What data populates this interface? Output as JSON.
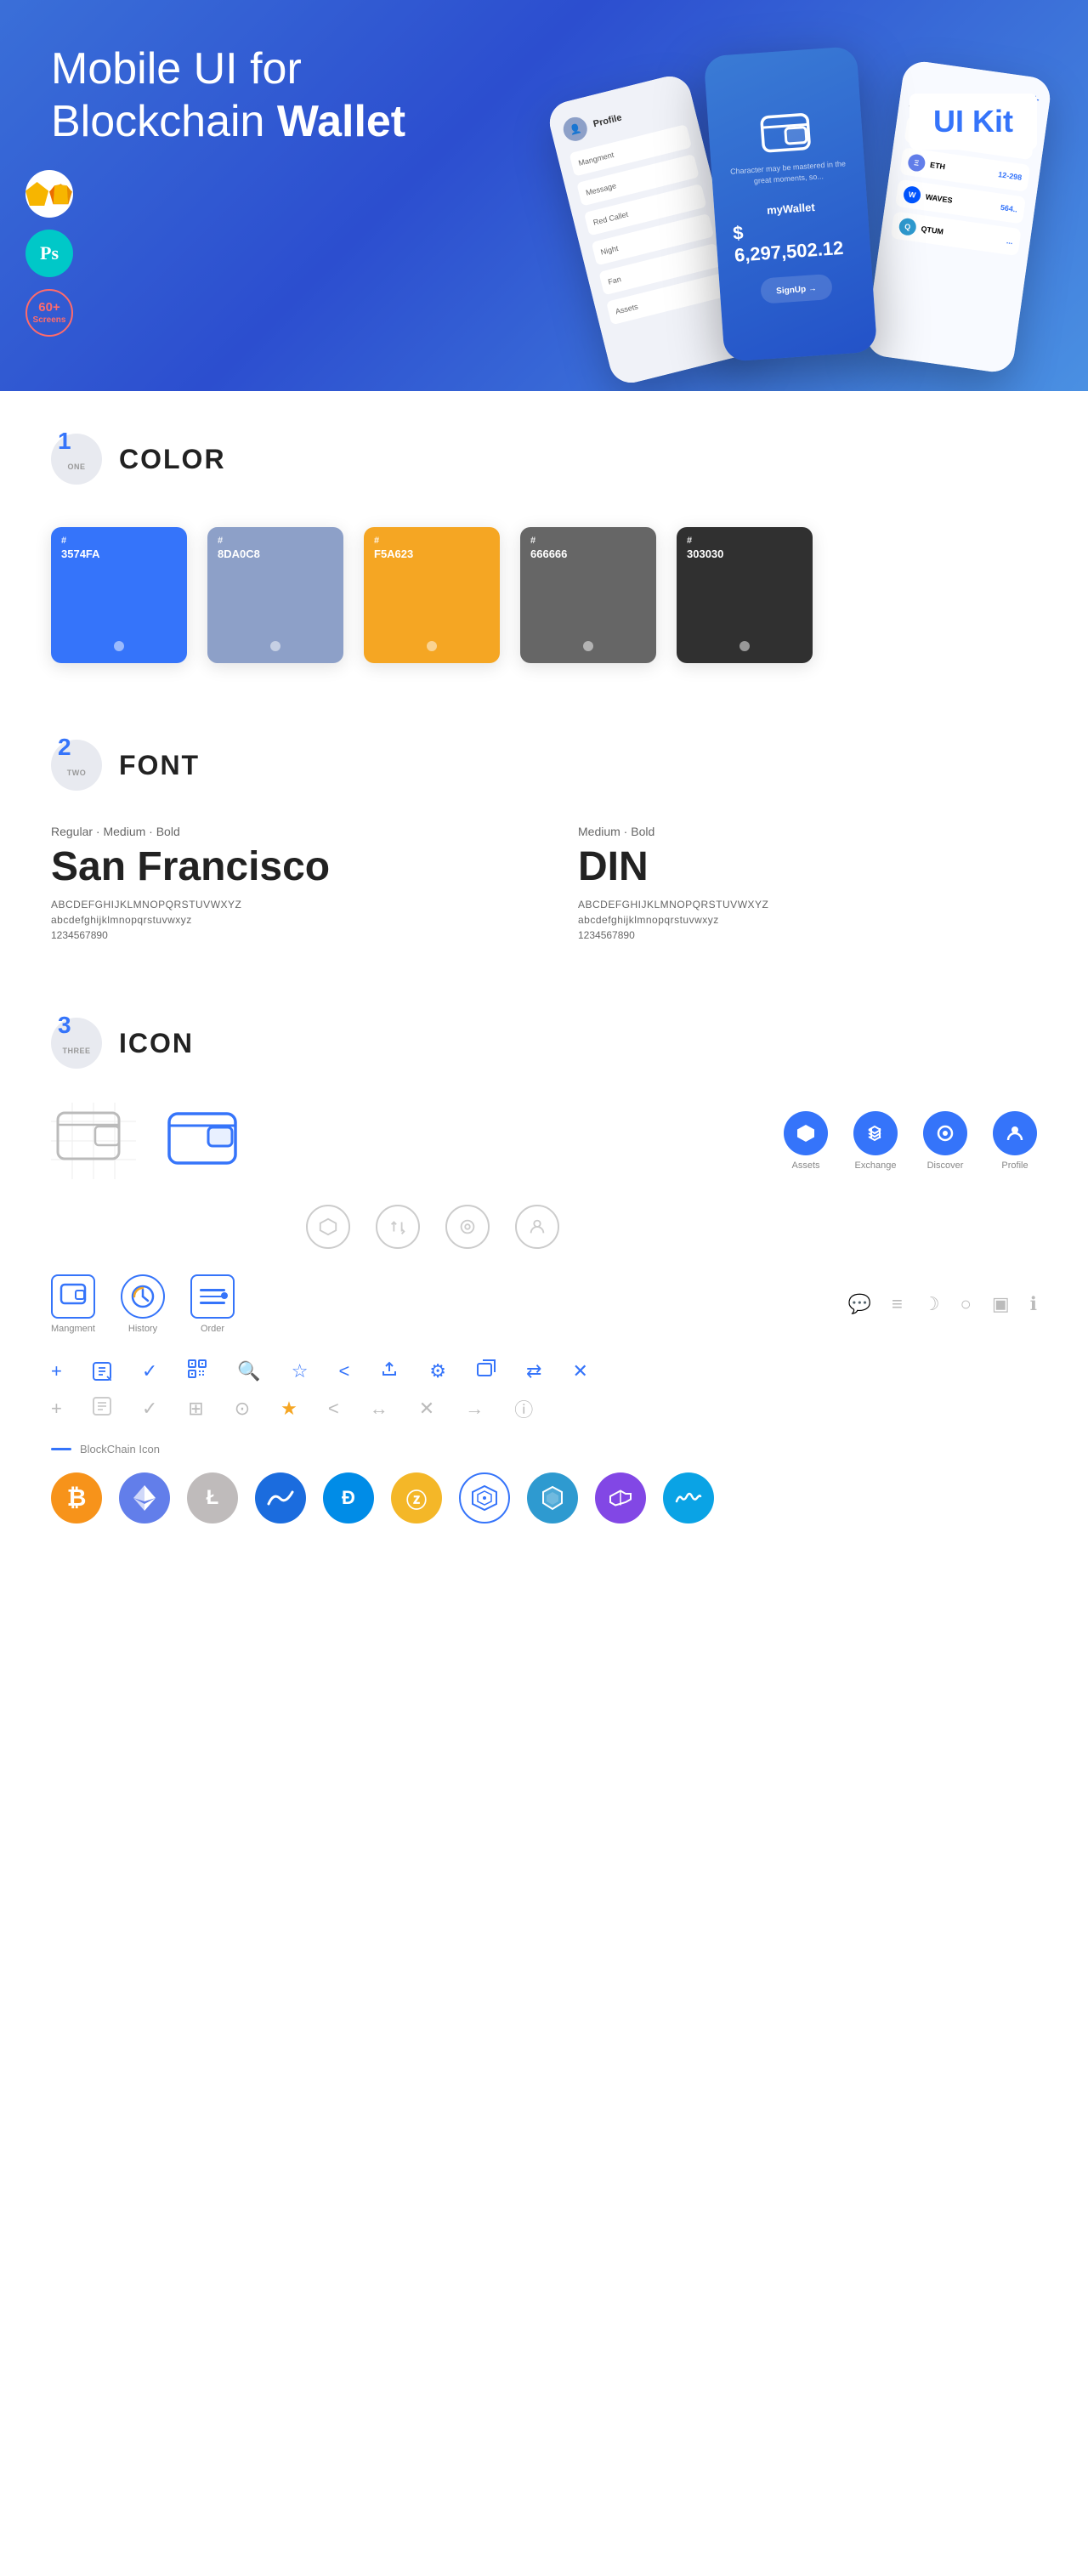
{
  "hero": {
    "title_normal": "Mobile UI for Blockchain ",
    "title_bold": "Wallet",
    "badge": "UI Kit",
    "badge_sketch": "Sketch",
    "badge_ps": "Ps",
    "badge_60": "60+",
    "badge_screens": "Screens"
  },
  "sections": {
    "color": {
      "number": "1",
      "word": "ONE",
      "title": "COLOR",
      "swatches": [
        {
          "code": "#",
          "hex": "3574FA",
          "color": "#3574FA"
        },
        {
          "code": "#",
          "hex": "8DA0C8",
          "color": "#8DA0C8"
        },
        {
          "code": "#",
          "hex": "F5A623",
          "color": "#F5A623"
        },
        {
          "code": "#",
          "hex": "666666",
          "color": "#666666"
        },
        {
          "code": "#",
          "hex": "303030",
          "color": "#303030"
        }
      ]
    },
    "font": {
      "number": "2",
      "word": "TWO",
      "title": "FONT",
      "font1": {
        "meta": "Regular · Medium · Bold",
        "name": "San Francisco",
        "upper": "ABCDEFGHIJKLMNOPQRSTUVWXYZ",
        "lower": "abcdefghijklmnopqrstuvwxyz",
        "numbers": "1234567890"
      },
      "font2": {
        "meta": "Medium · Bold",
        "name": "DIN",
        "upper": "ABCDEFGHIJKLMNOPQRSTUVWXYZ",
        "lower": "abcdefghijklmnopqrstuvwxyz",
        "numbers": "1234567890"
      }
    },
    "icon": {
      "number": "3",
      "word": "THREE",
      "title": "ICON",
      "nav_icons": [
        {
          "label": "Assets"
        },
        {
          "label": "Exchange"
        },
        {
          "label": "Discover"
        },
        {
          "label": "Profile"
        }
      ],
      "bottom_icons": [
        {
          "label": "Mangment"
        },
        {
          "label": "History"
        },
        {
          "label": "Order"
        }
      ],
      "blockchain_label": "BlockChain Icon",
      "coins": [
        {
          "label": "BTC",
          "color": "#F7931A"
        },
        {
          "label": "ETH",
          "color": "#627EEA"
        },
        {
          "label": "LTC",
          "color": "#BFBBBB"
        },
        {
          "label": "WAVES",
          "color": "#0055FF"
        },
        {
          "label": "DASH",
          "color": "#008CE7"
        },
        {
          "label": "ZEC",
          "color": "#F4B728"
        },
        {
          "label": "⬡",
          "color": "#3574FA",
          "outline": true
        },
        {
          "label": "QTUM",
          "color": "#2E9AD0"
        },
        {
          "label": "MATIC",
          "color": "#8247E5"
        },
        {
          "label": "~~",
          "color": "#0AA3E5"
        }
      ]
    }
  }
}
